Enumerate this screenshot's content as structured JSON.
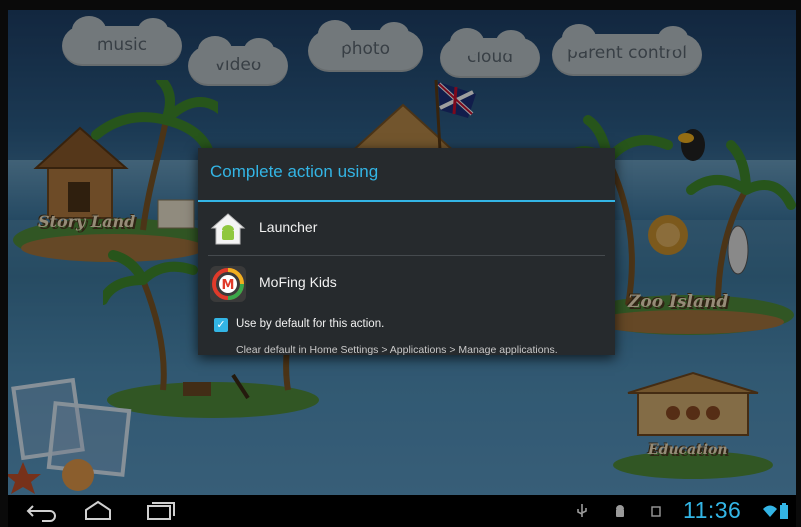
{
  "background": {
    "clouds": [
      {
        "label": "music"
      },
      {
        "label": "video"
      },
      {
        "label": "photo"
      },
      {
        "label": "cloud"
      },
      {
        "label": "parent control"
      }
    ],
    "islands": [
      {
        "label": "Story Land"
      },
      {
        "label": "Zoo Island"
      },
      {
        "label": "Education"
      }
    ]
  },
  "dialog": {
    "title": "Complete action using",
    "apps": [
      {
        "label": "Launcher",
        "icon": "android-home-icon"
      },
      {
        "label": "MoFing Kids",
        "icon": "mofing-kids-icon"
      }
    ],
    "default_checkbox": {
      "label": "Use by default for this action.",
      "checked": true
    },
    "hint": "Clear default in Home Settings > Applications > Manage applications."
  },
  "navbar": {
    "back": "back-icon",
    "home": "home-icon",
    "recents": "recent-apps-icon"
  },
  "status": {
    "time": "11:36",
    "accent": "#33b5e5"
  }
}
